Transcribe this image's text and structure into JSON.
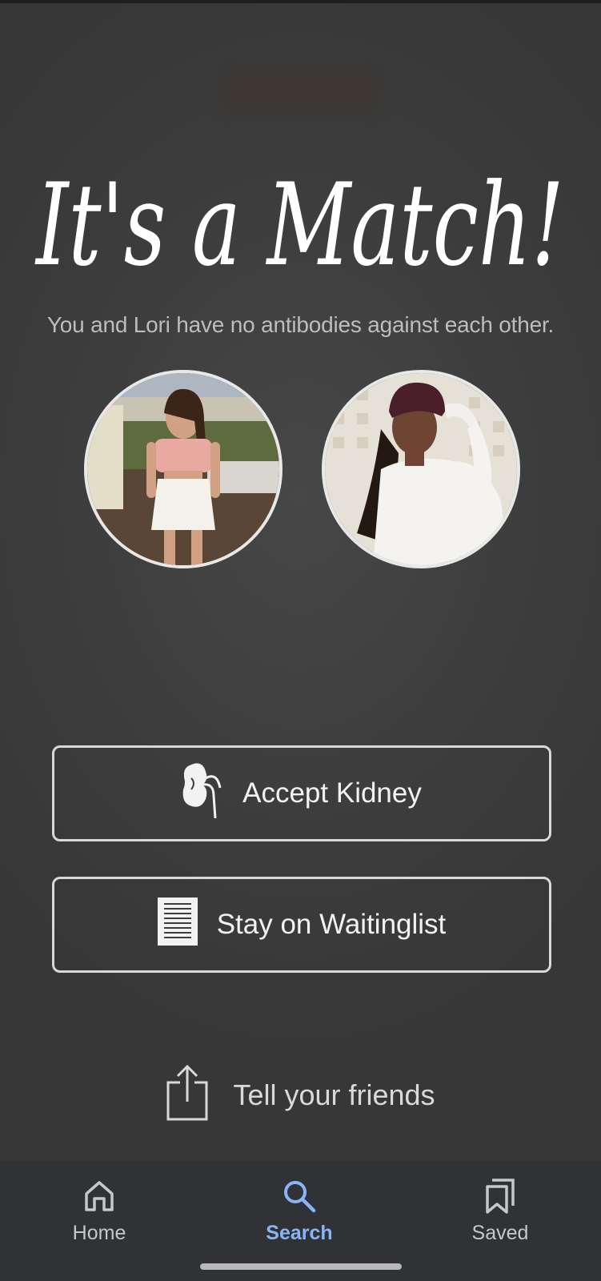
{
  "match": {
    "title": "It's a Match!",
    "subtitle": "You and Lori have no antibodies against each other."
  },
  "avatars": [
    {
      "name": "match-photo-lori"
    },
    {
      "name": "match-photo-self"
    }
  ],
  "actions": {
    "accept_label": "Accept Kidney",
    "waitlist_label": "Stay on Waitinglist",
    "share_label": "Tell your friends"
  },
  "icons": {
    "accept": "kidney-icon",
    "waitlist": "list-document-icon",
    "share": "share-icon"
  },
  "bottom_nav": {
    "items": [
      {
        "label": "Home",
        "icon": "home-icon",
        "active": false
      },
      {
        "label": "Search",
        "icon": "search-icon",
        "active": true
      },
      {
        "label": "Saved",
        "icon": "bookmarks-icon",
        "active": false
      }
    ],
    "active_color": "#8ab4f8",
    "inactive_color": "#c4c7cc"
  }
}
